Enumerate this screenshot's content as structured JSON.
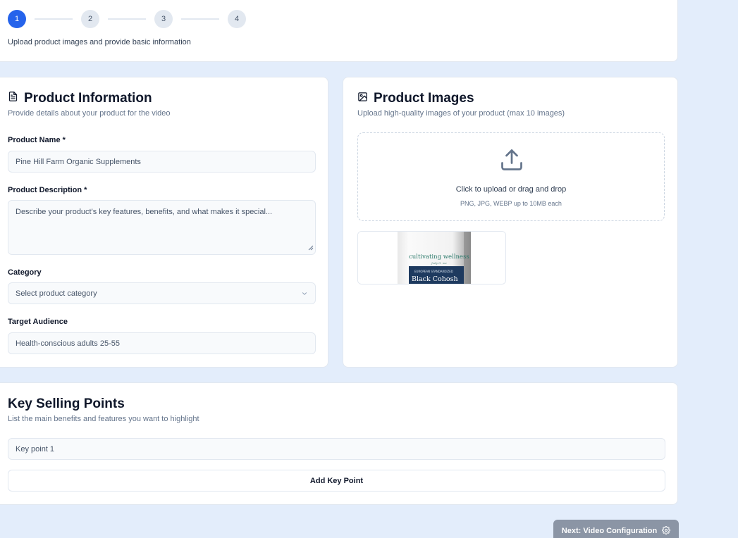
{
  "stepper": {
    "steps": [
      "1",
      "2",
      "3",
      "4"
    ],
    "active_step": "1",
    "subtitle": "Upload product images and provide basic information"
  },
  "product_info": {
    "title": "Product Information",
    "description": "Provide details about your product for the video",
    "icon": "document-icon",
    "fields": {
      "name": {
        "label": "Product Name *",
        "value": "Pine Hill Farm Organic Supplements"
      },
      "description": {
        "label": "Product Description *",
        "placeholder": "Describe your product's key features, benefits, and what makes it special..."
      },
      "category": {
        "label": "Category",
        "placeholder": "Select product category"
      },
      "audience": {
        "label": "Target Audience",
        "value": "Health-conscious adults 25-55"
      }
    }
  },
  "product_images": {
    "title": "Product Images",
    "description": "Upload high-quality images of your product (max 10 images)",
    "icon": "image-icon",
    "upload": {
      "main_text": "Click to upload or drag and drop",
      "sub_text": "PNG, JPG, WEBP up to 10MB each"
    },
    "thumbnails": [
      {
        "brand": "cultivating wellness",
        "tag": "EUROPEAN STANDARDIZED",
        "product": "Black Cohosh"
      }
    ]
  },
  "key_points": {
    "title": "Key Selling Points",
    "description": "List the main benefits and features you want to highlight",
    "inputs": [
      {
        "placeholder": "Key point 1"
      }
    ],
    "add_label": "Add Key Point"
  },
  "footer": {
    "next_label": "Next: Video Configuration",
    "next_icon": "gear-icon"
  },
  "colors": {
    "primary": "#2563eb",
    "background": "#e3edfb",
    "disabled_button": "#8b95a5"
  }
}
